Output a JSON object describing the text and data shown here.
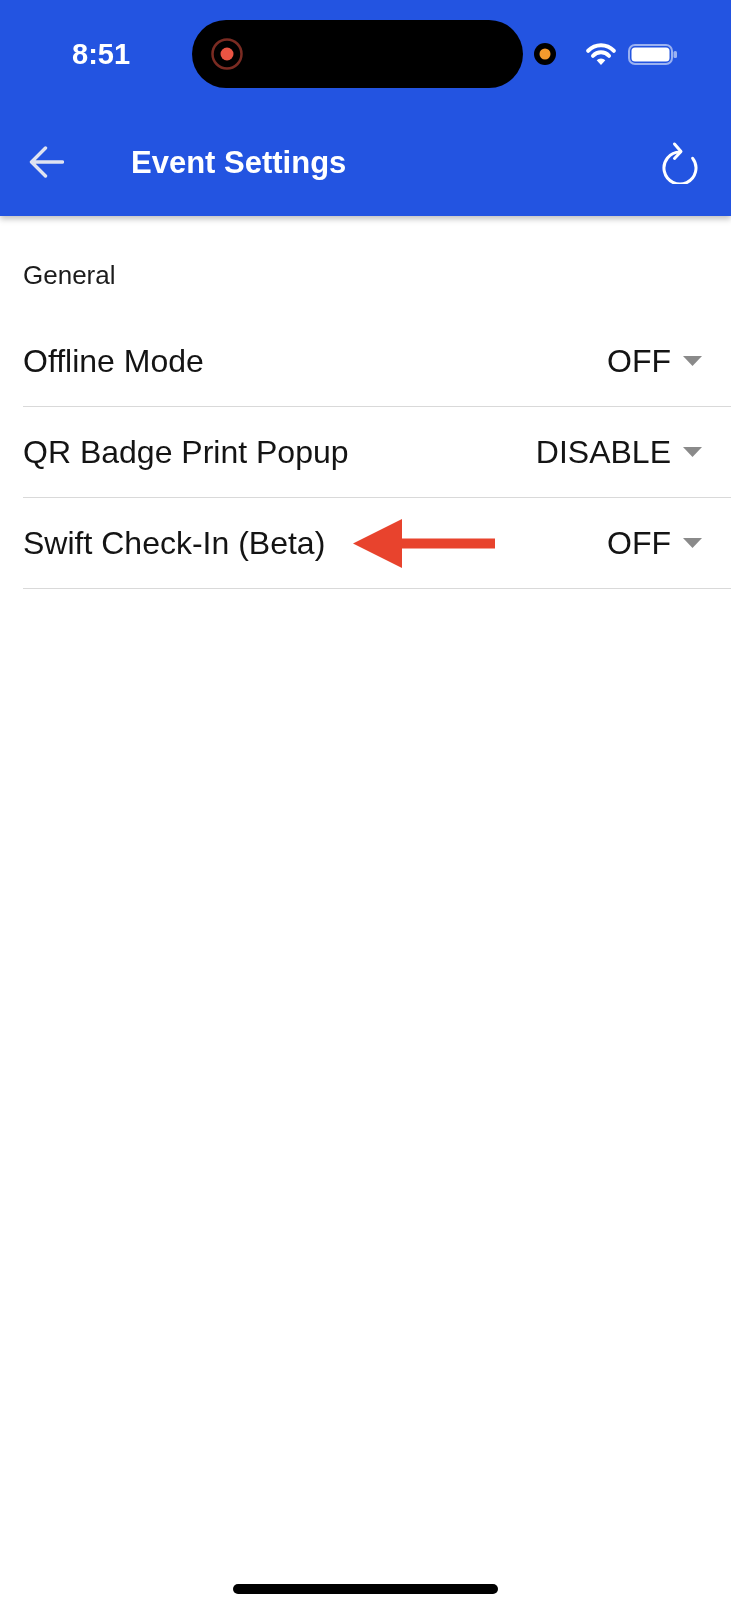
{
  "status_bar": {
    "time": "8:51"
  },
  "header": {
    "title": "Event Settings"
  },
  "section": {
    "title": "General"
  },
  "settings": [
    {
      "label": "Offline Mode",
      "value": "OFF",
      "annotated": false
    },
    {
      "label": "QR Badge Print Popup",
      "value": "DISABLE",
      "annotated": false
    },
    {
      "label": "Swift Check-In (Beta)",
      "value": "OFF",
      "annotated": true
    }
  ]
}
